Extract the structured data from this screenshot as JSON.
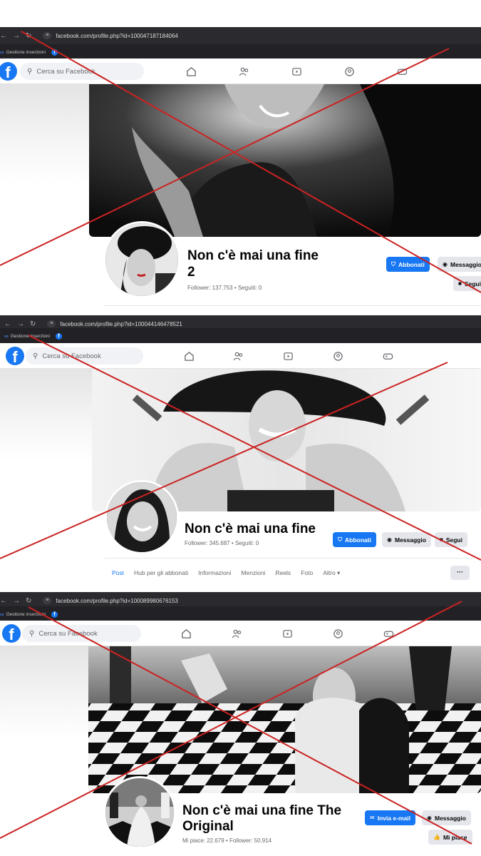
{
  "colors": {
    "fb_blue": "#1877f2",
    "chrome_dark": "#2b2b2f",
    "cross_red": "#cc2222"
  },
  "icons": [
    "back-arrow-icon",
    "forward-arrow-icon",
    "reload-icon",
    "site-info-icon",
    "meta-icon",
    "facebook-logo-icon",
    "search-icon",
    "home-icon",
    "friends-icon",
    "video-icon",
    "groups-icon",
    "gaming-icon",
    "shield-icon",
    "messenger-icon",
    "lock-icon",
    "mail-icon",
    "like-icon"
  ],
  "panels": [
    {
      "url": "facebook.com/profile.php?id=100047187184064",
      "bookmark": "Gestione inserzioni",
      "search_placeholder": "Cerca su Facebook",
      "name_line1": "Non c'è mai una fine",
      "name_line2": "2",
      "stats": "Follower: 137.753 • Seguiti: 0",
      "btn_primary": "Abbonati",
      "btn_secondary": "Messaggio",
      "btn_third": "Segui"
    },
    {
      "url": "facebook.com/profile.php?id=100044146478521",
      "bookmark": "Gestione inserzioni",
      "search_placeholder": "Cerca su Facebook",
      "name_line1": "Non c'è mai una fine",
      "stats": "Follower: 345.687 • Seguiti: 0",
      "btn_primary": "Abbonati",
      "btn_secondary": "Messaggio",
      "btn_third": "Segui",
      "tabs": [
        "Post",
        "Hub per gli abbonati",
        "Informazioni",
        "Menzioni",
        "Reels",
        "Foto",
        "Altro ▾"
      ],
      "more": "···"
    },
    {
      "url": "facebook.com/profile.php?id=100089980676153",
      "bookmark": "Gestione inserzioni",
      "search_placeholder": "Cerca su Facebook",
      "name_line1": "Non c'è mai una fine The",
      "name_line2": "Original",
      "stats": "Mi piace: 22.679 • Follower: 50.914",
      "btn_primary": "Invia e-mail",
      "btn_secondary": "Messaggio",
      "btn_third": "Mi piace"
    }
  ]
}
